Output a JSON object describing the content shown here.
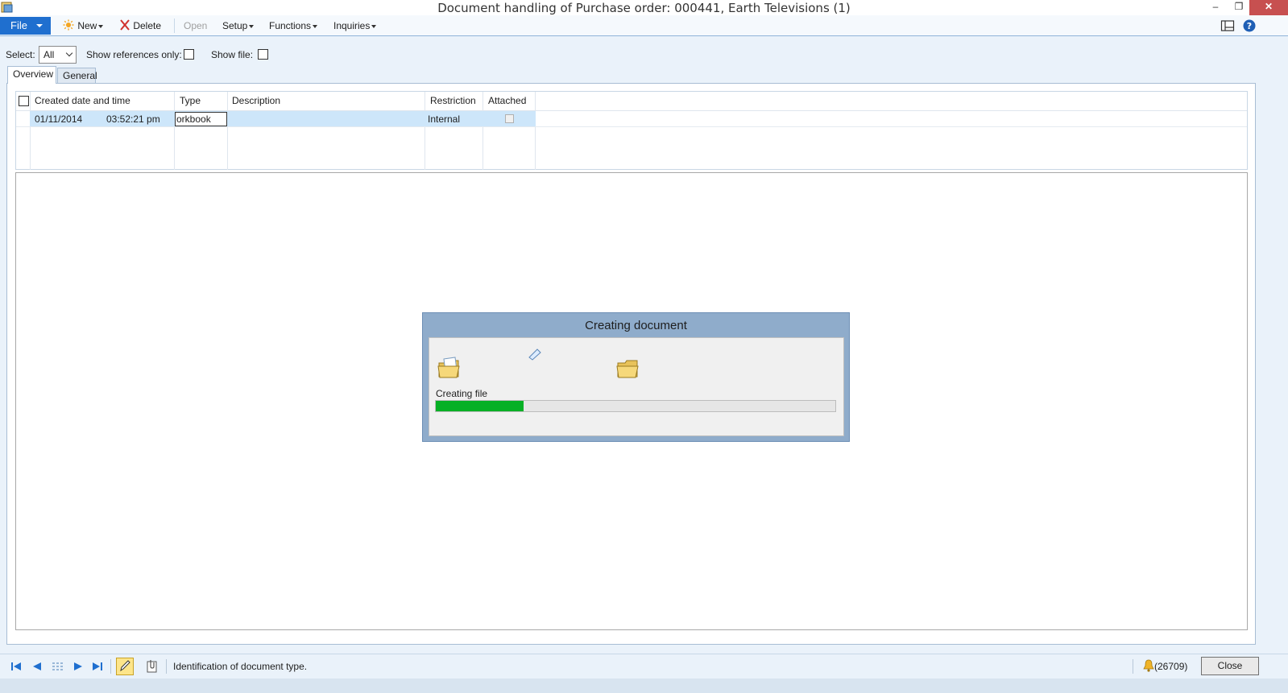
{
  "window": {
    "title": "Document handling of Purchase order: 000441, Earth Televisions (1)",
    "min_glyph": "–",
    "max_glyph": "❐",
    "close_glyph": "✕"
  },
  "action_pane": {
    "file_label": "File",
    "new_label": "New",
    "delete_label": "Delete",
    "open_label": "Open",
    "setup_label": "Setup",
    "functions_label": "Functions",
    "inquiries_label": "Inquiries"
  },
  "filter": {
    "select_label": "Select:",
    "select_value": "All",
    "show_references_label": "Show references only:",
    "show_file_label": "Show file:"
  },
  "tabs": {
    "overview": "Overview",
    "general": "General"
  },
  "grid": {
    "columns": {
      "created": "Created date and time",
      "type": "Type",
      "description": "Description",
      "restriction": "Restriction",
      "attached": "Attached"
    },
    "rows": [
      {
        "date": "01/11/2014",
        "time": "03:52:21 pm",
        "type": "orkbook",
        "description": "",
        "restriction": "Internal"
      }
    ]
  },
  "dialog": {
    "title": "Creating document",
    "status": "Creating file",
    "progress": 0.22
  },
  "status_bar": {
    "help_text": "Identification of document type.",
    "notification_count": "(26709)",
    "close_label": "Close"
  },
  "colors": {
    "accent": "#1f6fcf",
    "progress_fill": "#06b025",
    "selected_row": "#cde6fa",
    "dialog_frame": "#8faccb"
  }
}
